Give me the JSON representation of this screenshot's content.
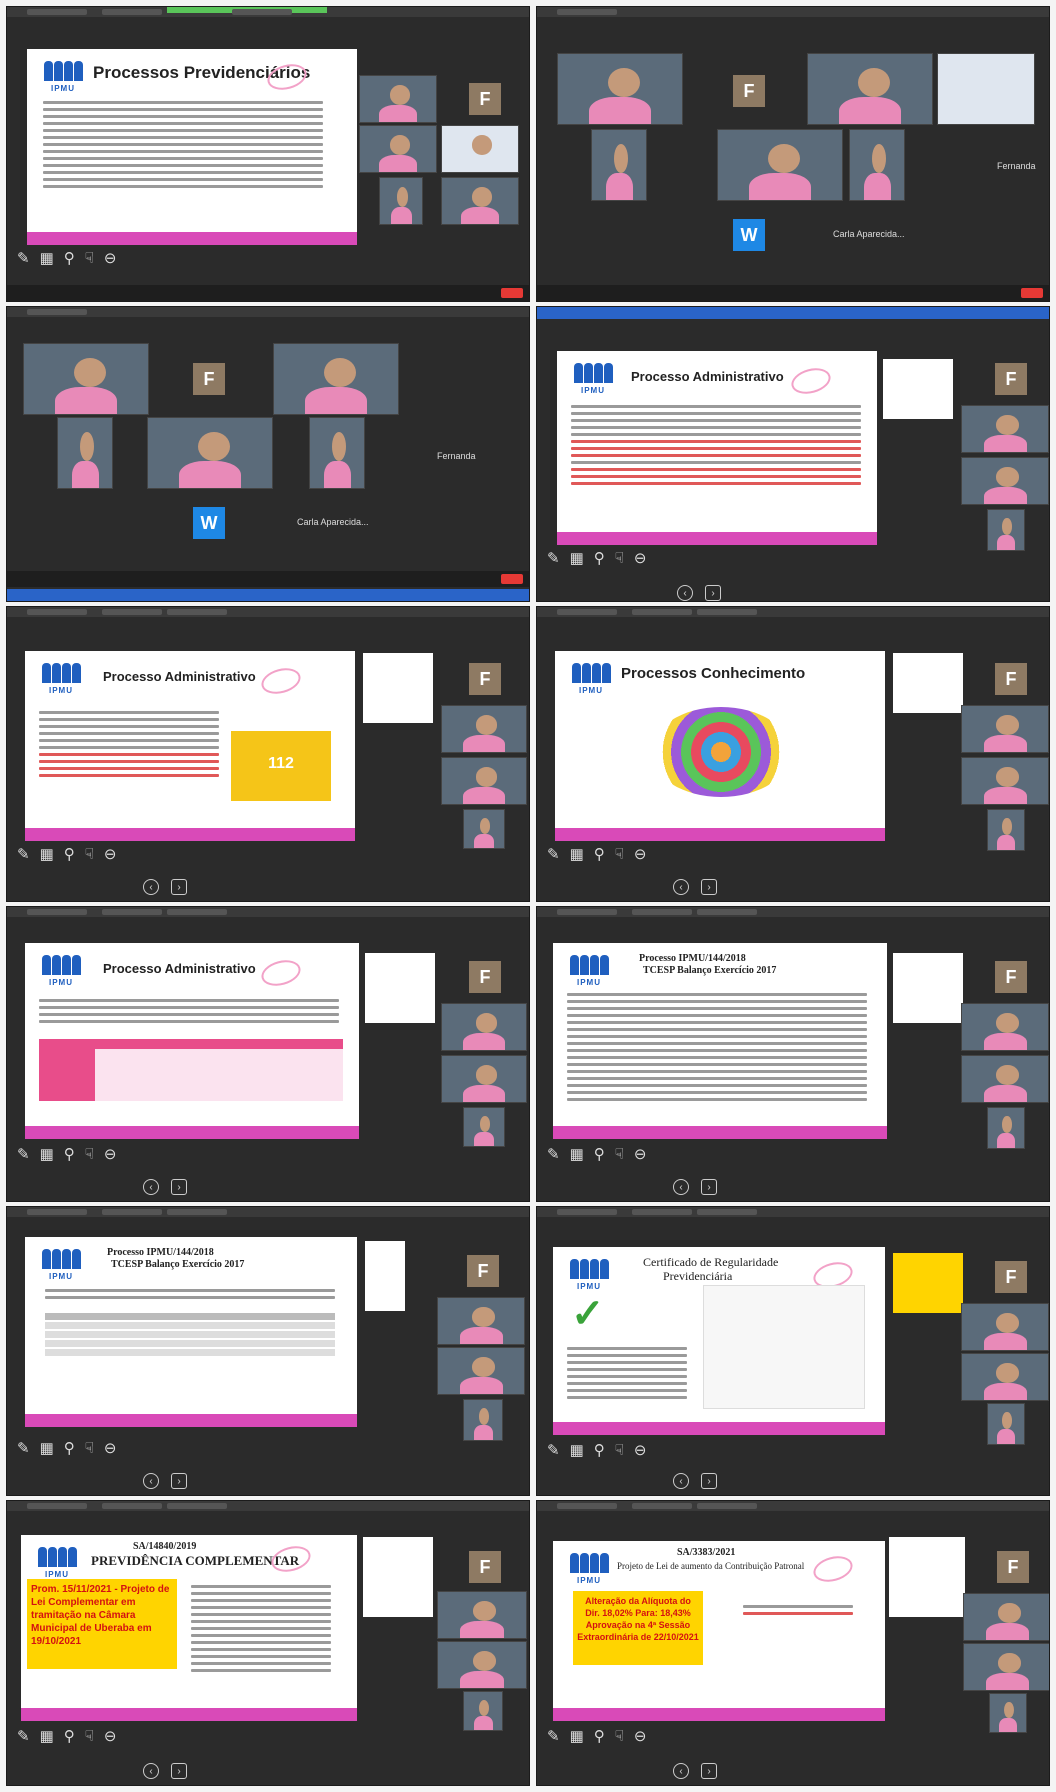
{
  "panels": [
    {
      "title": "Processos Previdenciários"
    },
    {
      "participants": {
        "avatar_f": "F",
        "avatar_w": "W",
        "name_fernanda": "Fernanda",
        "name_carla": "Carla Aparecida..."
      }
    },
    {
      "participants": {
        "avatar_f": "F",
        "avatar_w": "W",
        "name_fernanda": "Fernanda",
        "name_carla": "Carla Aparecida..."
      }
    },
    {
      "title": "Processo Administrativo"
    },
    {
      "title": "Processo Administrativo",
      "counter": "112"
    },
    {
      "title": "Processos Conhecimento"
    },
    {
      "title": "Processo Administrativo"
    },
    {
      "title_line1": "Processo IPMU/144/2018",
      "title_line2": "TCESP Balanço Exercício 2017"
    },
    {
      "title_line1": "Processo IPMU/144/2018",
      "title_line2": "TCESP Balanço Exercício 2017"
    },
    {
      "title_line1": "Certificado de Regularidade",
      "title_line2": "Previdenciária"
    },
    {
      "title_line1": "SA/14840/2019",
      "title_line2": "PREVIDÊNCIA COMPLEMENTAR",
      "box": "Prom. 15/11/2021 - Projeto de Lei Complementar em tramitação na Câmara Municipal de Uberaba em 19/10/2021"
    },
    {
      "title_line1": "SA/3383/2021",
      "title_line2": "Projeto de Lei de aumento da Contribuição Patronal",
      "box": "Alteração da Alíquota do Dir. 18,02% Para: 18,43% Aprovação na 4ª Sessão Extraordinária de 22/10/2021"
    }
  ],
  "logo_text": "IPMU",
  "colors": {
    "accent_pink": "#d94ab8",
    "zoom_bg": "#2b2b2b",
    "avatar_f": "#8e7a63",
    "avatar_w": "#1e88e5"
  }
}
